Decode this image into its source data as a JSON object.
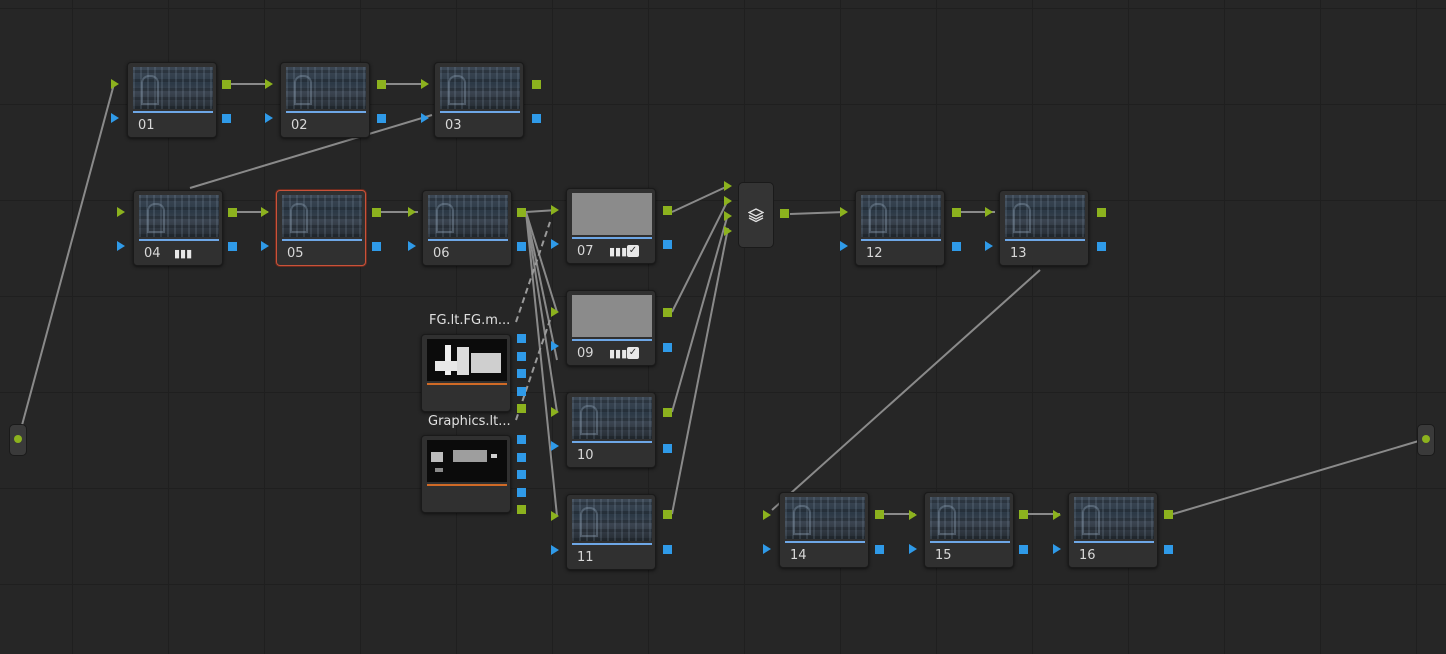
{
  "colors": {
    "rgb_port": "#8cb21e",
    "alpha_port": "#2f9ae8",
    "selected_border": "#c9533a",
    "connection_line": "#8a8a8a"
  },
  "nodes": {
    "n01": {
      "label": "01"
    },
    "n02": {
      "label": "02"
    },
    "n03": {
      "label": "03"
    },
    "n04": {
      "label": "04"
    },
    "n05": {
      "label": "05"
    },
    "n06": {
      "label": "06"
    },
    "n07": {
      "label": "07"
    },
    "n09": {
      "label": "09"
    },
    "n10": {
      "label": "10"
    },
    "n11": {
      "label": "11"
    },
    "n12": {
      "label": "12"
    },
    "n13": {
      "label": "13"
    },
    "n14": {
      "label": "14"
    },
    "n15": {
      "label": "15"
    },
    "n16": {
      "label": "16"
    }
  },
  "external_mattes": [
    {
      "label": "FG.lt.FG.m..."
    },
    {
      "label": "Graphics.lt..."
    }
  ],
  "layer_mixer": {
    "icon": "layers-icon"
  },
  "source": {
    "icon": "source-input-icon"
  },
  "output": {
    "icon": "output-icon"
  }
}
